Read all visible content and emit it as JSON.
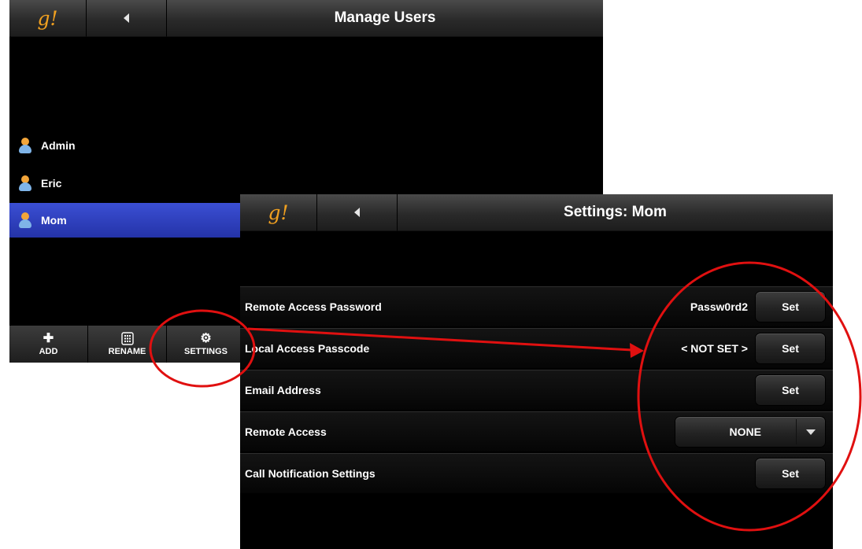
{
  "users_screen": {
    "logo": "g!",
    "title": "Manage Users",
    "users": [
      {
        "name": "Admin",
        "selected": false
      },
      {
        "name": "Eric",
        "selected": false
      },
      {
        "name": "Mom",
        "selected": true
      }
    ],
    "toolbar": {
      "add_label": "ADD",
      "rename_label": "RENAME",
      "settings_label": "SETTINGS"
    }
  },
  "settings_screen": {
    "logo": "g!",
    "title": "Settings: Mom",
    "rows": {
      "remote_password": {
        "label": "Remote Access Password",
        "value": "Passw0rd2",
        "button": "Set"
      },
      "local_passcode": {
        "label": "Local Access Passcode",
        "value": "< NOT SET >",
        "button": "Set"
      },
      "email": {
        "label": "Email Address",
        "button": "Set"
      },
      "remote_access": {
        "label": "Remote Access",
        "selected": "NONE"
      },
      "call_notification": {
        "label": "Call Notification Settings",
        "button": "Set"
      }
    }
  },
  "colors": {
    "accent_logo": "#f0a020",
    "selection": "#2f40c4",
    "annotation": "#e01010"
  }
}
